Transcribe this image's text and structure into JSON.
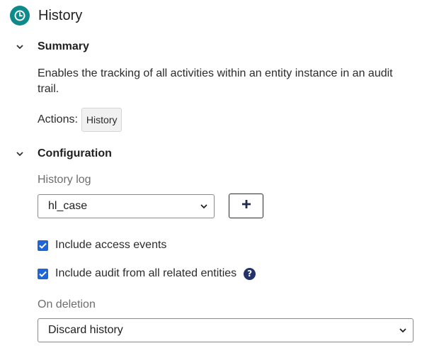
{
  "header": {
    "title": "History",
    "icon": "clock-icon",
    "accent": "#0f8a8a"
  },
  "summary": {
    "title": "Summary",
    "description": "Enables the tracking of all activities within an entity instance in an audit trail.",
    "actions_label": "Actions:",
    "actions": [
      "History"
    ]
  },
  "configuration": {
    "title": "Configuration",
    "history_log": {
      "label": "History log",
      "value": "hl_case"
    },
    "include_access_events": {
      "label": "Include access events",
      "checked": true
    },
    "include_audit_related": {
      "label": "Include audit from all related entities",
      "checked": true
    },
    "on_deletion": {
      "label": "On deletion",
      "value": "Discard history"
    }
  },
  "colors": {
    "checkbox": "#1e66d8",
    "button_border": "#1d2b4f",
    "help": "#23326b"
  }
}
